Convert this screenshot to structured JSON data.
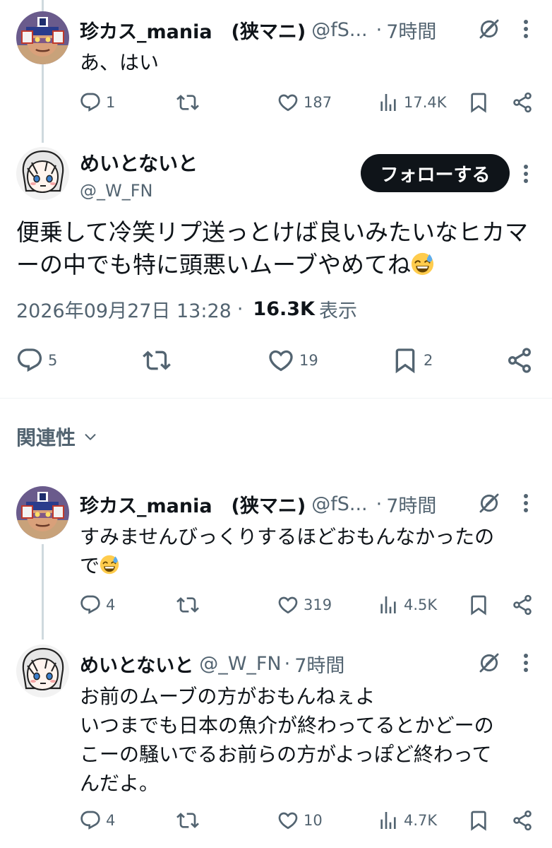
{
  "tweets": [
    {
      "display_name": "珍カス_mania　(狭マニ)",
      "handle": "@fS...",
      "separator": "·",
      "time": "7時間",
      "text": "あ、はい",
      "emoji": "",
      "replies": "1",
      "likes": "187",
      "views": "17.4K"
    },
    {
      "display_name": "珍カス_mania　(狭マニ)",
      "handle": "@fS...",
      "separator": "·",
      "time": "7時間",
      "text": "すみませんびっくりするほどおもんなかったの\nで",
      "emoji": "sweat-smile-emoji",
      "replies": "4",
      "likes": "319",
      "views": "4.5K"
    },
    {
      "display_name": "めいとないと",
      "handle": "@_W_FN",
      "separator": "·",
      "time": "7時間",
      "text": "お前のムーブの方がおもんねぇよ\nいつまでも日本の魚介が終わってるとかどーの\nこーの騒いでるお前らの方がよっぽど終わって\nんだよ。",
      "emoji": "",
      "replies": "4",
      "likes": "10",
      "views": "4.7K"
    }
  ],
  "main_tweet": {
    "display_name": "めいとないと",
    "handle": "@_W_FN",
    "follow_label": "フォローする",
    "text": "便乗して冷笑リプ送っとけば良いみたいなヒカマーの中でも特に頭悪いムーブやめてね",
    "emoji": "sweat-smile-emoji",
    "timestamp": "2026年09月27日 13:28",
    "dot": "·",
    "views": "16.3K",
    "views_label": "表示",
    "replies": "5",
    "likes": "19",
    "bookmarks": "2"
  },
  "sort": {
    "label": "関連性",
    "icon": "chevron-down-icon"
  },
  "colors": {
    "text": "#0f1419",
    "secondary": "#536471",
    "thread_line": "#cfd9de",
    "button_bg": "#0f1419"
  }
}
